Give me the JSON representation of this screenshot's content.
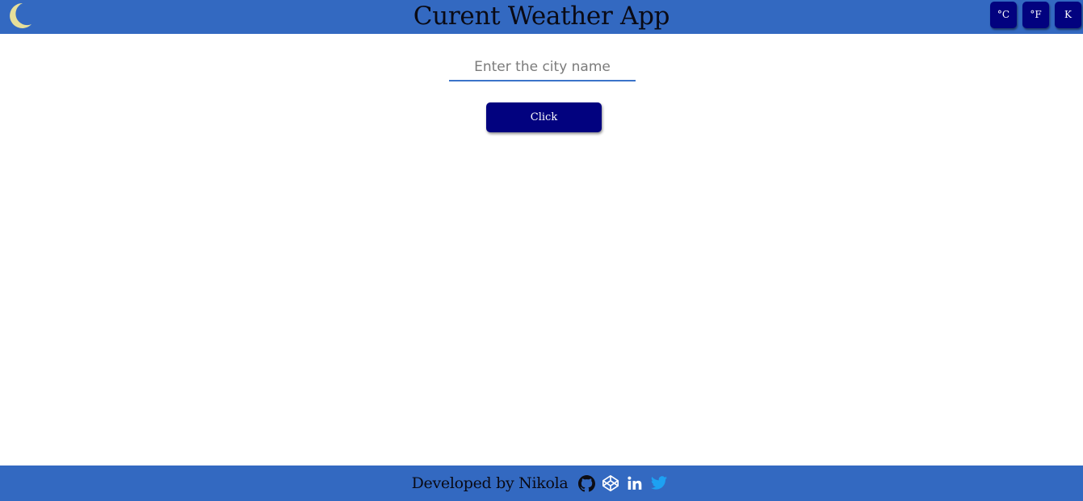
{
  "header": {
    "title": "Curent Weather App",
    "theme_icon": "moon-icon",
    "units": [
      {
        "label": "°C"
      },
      {
        "label": "°F"
      },
      {
        "label": "K"
      }
    ]
  },
  "search": {
    "placeholder": "Enter the city name",
    "value": "",
    "button_label": "Click"
  },
  "footer": {
    "credit": "Developed by Nikola",
    "links": [
      {
        "icon": "github-icon"
      },
      {
        "icon": "codepen-icon"
      },
      {
        "icon": "linkedin-icon"
      },
      {
        "icon": "twitter-icon"
      }
    ]
  },
  "colors": {
    "bar": "#3369c1",
    "button": "#02027f",
    "moon": "#e6df9a",
    "twitter": "#1da1f2"
  }
}
